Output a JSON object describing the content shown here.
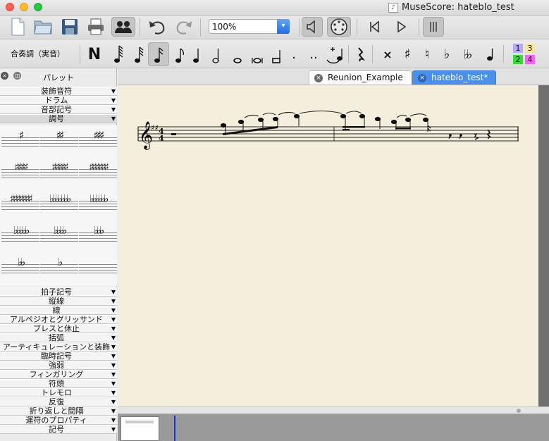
{
  "window": {
    "title": "MuseScore: hateblo_test"
  },
  "toolbar": {
    "zoom_value": "100%",
    "zoom_arrow": "▾",
    "concert_pitch_label": "合奏調（実音）",
    "note_n_label": "N",
    "note_dot_label": ".",
    "note_ddot_label": "..",
    "buttons": [
      "new-file-icon",
      "open-file-icon",
      "save-icon",
      "print-icon",
      "mixer-icon",
      "undo-icon",
      "redo-icon",
      "speaker-icon",
      "midi-input-icon",
      "rewind-icon",
      "play-icon",
      "loop-icon"
    ],
    "accent_color": "#1f6ee0"
  },
  "voices": {
    "v1": "1",
    "v2": "2",
    "v3": "3",
    "v4": "4",
    "v1_color": "#b7a9f2",
    "v2_color": "#3ad83a",
    "v3_color": "#f7e6a0",
    "v4_color": "#ee66ee"
  },
  "palette": {
    "title": "パレット",
    "close_glyph": "×",
    "float_glyph": "◫",
    "arrow_glyph": "▼",
    "sections_top": [
      "装飾音符",
      "ドラム",
      "音部記号",
      "調号"
    ],
    "key_signatures": [
      "♯",
      "♯♯",
      "♯♯♯",
      "♯♯♯♯",
      "♯♯♯♯♯",
      "♯♯♯♯♯♯",
      "♯♯♯♯♯♯♯",
      "♭♭♭♭♭♭♭",
      "♭♭♭♭♭♭",
      "♭♭♭♭♭",
      "♭♭♭♭",
      "♭♭♭",
      "♭♭",
      "♭",
      ""
    ],
    "sections_bottom": [
      "拍子記号",
      "縦線",
      "線",
      "アルペジオとグリッサンド",
      "ブレスと休止",
      "括弧",
      "アーティキュレーションと装飾",
      "臨時記号",
      "強弱",
      "フィンガリング",
      "符頭",
      "トレモロ",
      "反復",
      "折り返しと間隔",
      "運符のプロパティ",
      "記号"
    ]
  },
  "tabs": [
    {
      "label": "Reunion_Example",
      "close": "×"
    },
    {
      "label": "hateblo_test*",
      "close": "×",
      "active": true
    }
  ],
  "score": {
    "clef": "𝄞",
    "time_signature": "4",
    "key": "♯♯"
  }
}
